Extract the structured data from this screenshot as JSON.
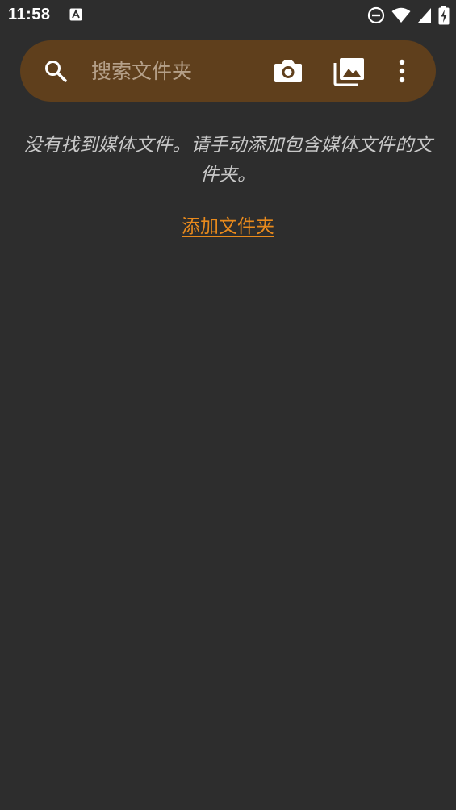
{
  "status_bar": {
    "time": "11:58",
    "icons": [
      "font-a-notification-icon",
      "do-not-disturb-icon",
      "wifi-icon",
      "cell-signal-icon",
      "battery-charging-icon"
    ]
  },
  "search_bar": {
    "placeholder": "搜索文件夹",
    "background_color": "#5f3f1c",
    "icons": [
      "search-icon",
      "camera-icon",
      "gallery-icon",
      "more-vert-icon"
    ]
  },
  "empty_state": {
    "message": "没有找到媒体文件。请手动添加包含媒体文件的文件夹。",
    "add_folder_label": "添加文件夹",
    "link_color": "#e98a1c"
  },
  "colors": {
    "background": "#2d2d2d",
    "text_secondary": "#c8c8c8"
  }
}
